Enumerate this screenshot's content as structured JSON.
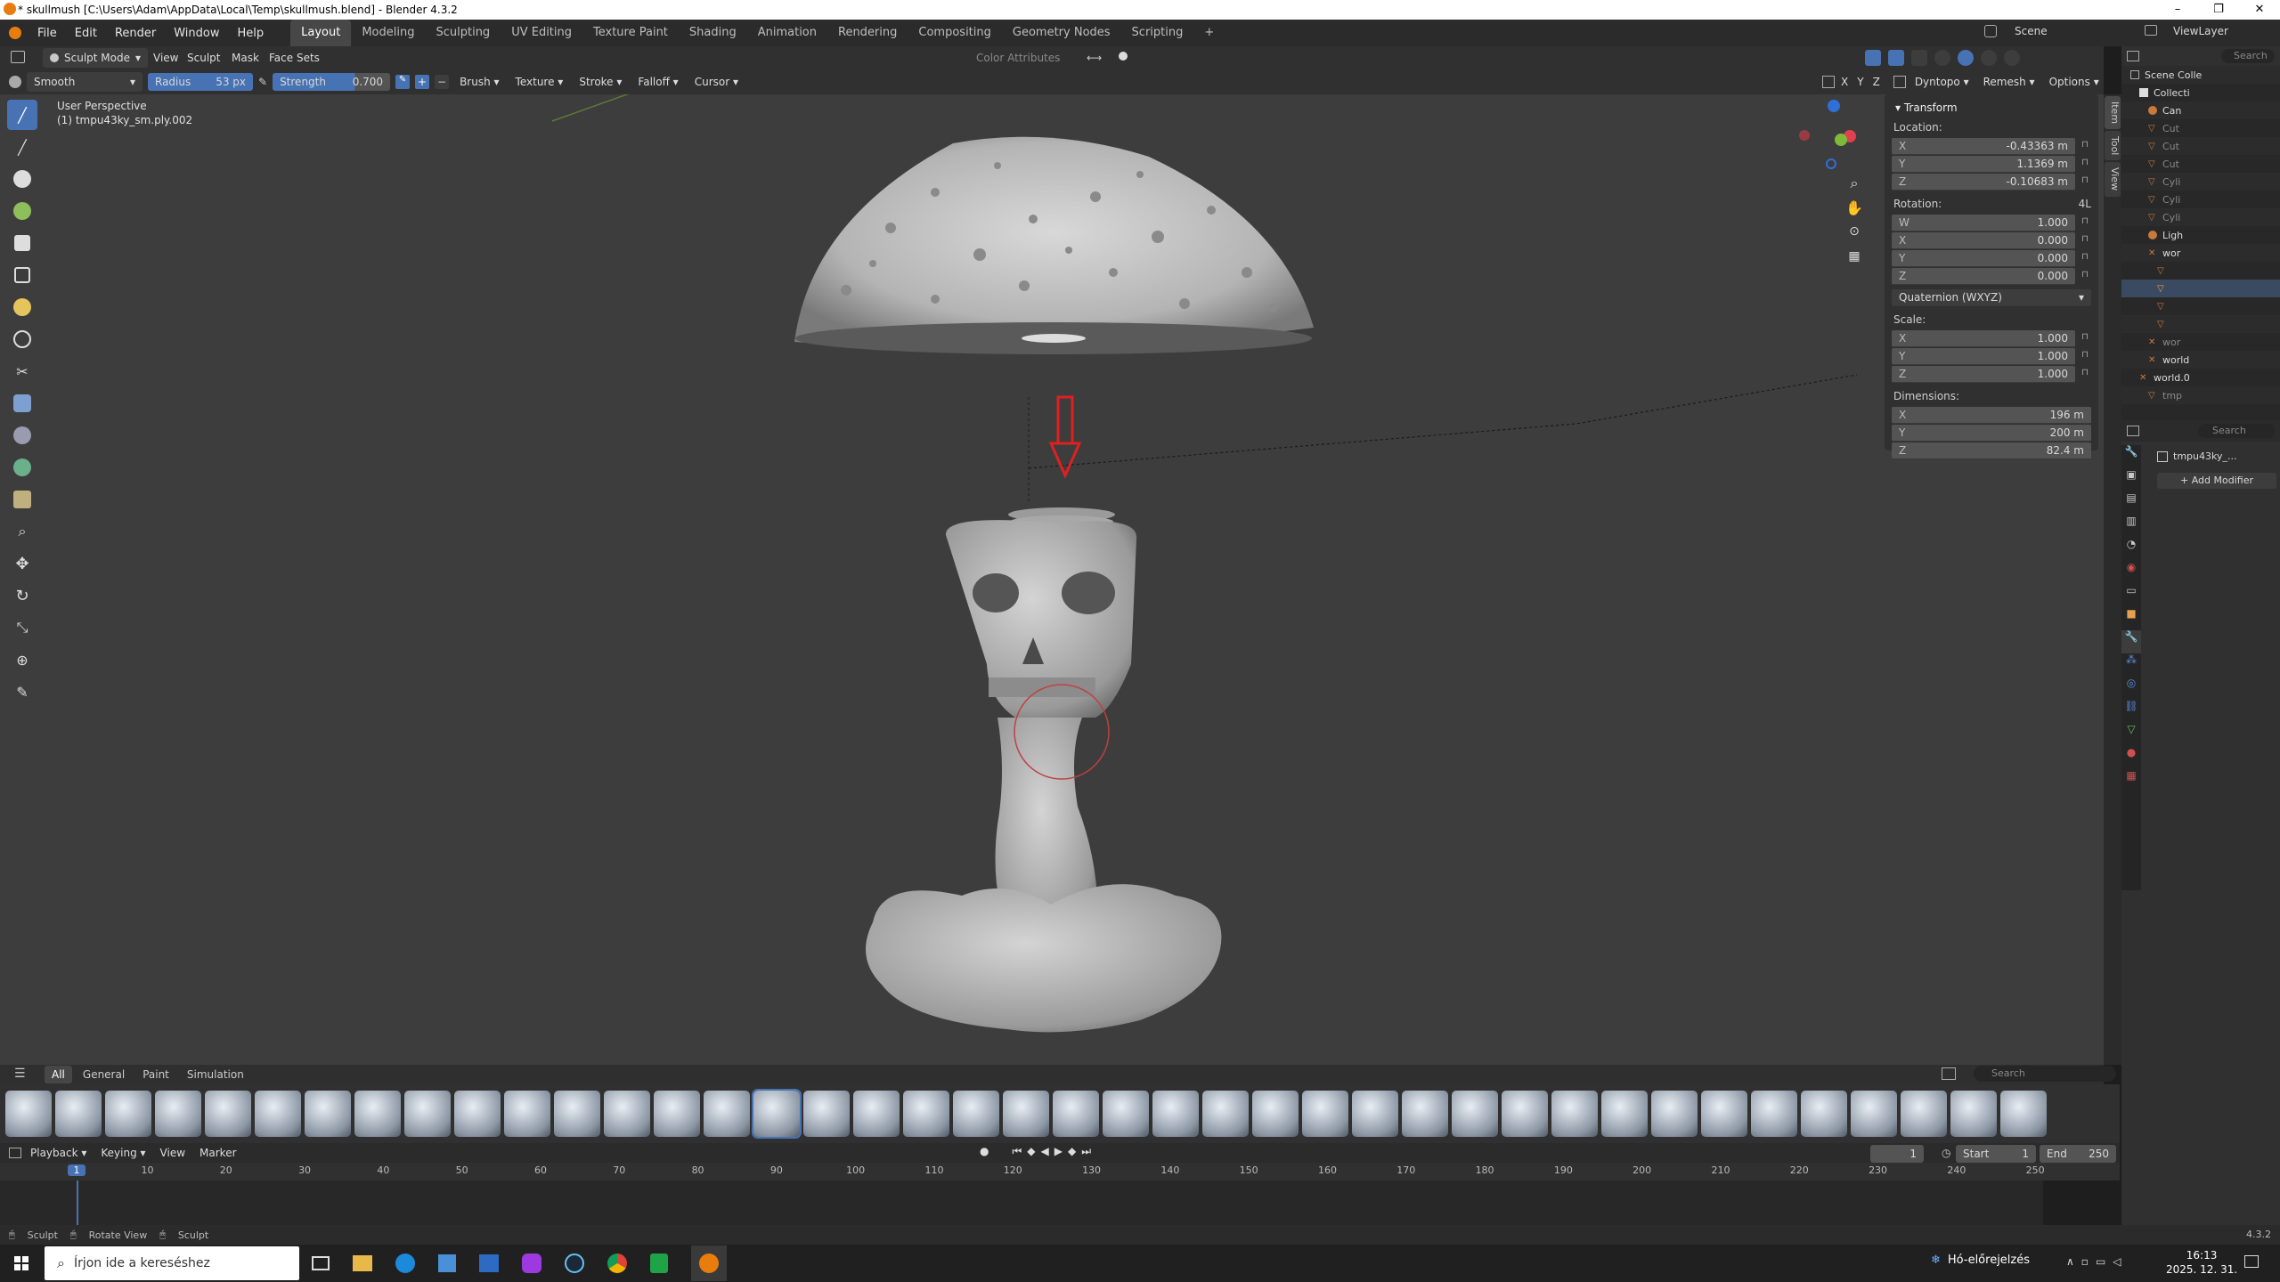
{
  "window": {
    "title": "* skullmush [C:\\Users\\Adam\\AppData\\Local\\Temp\\skullmush.blend] - Blender 4.3.2",
    "controls": [
      "–",
      "❐",
      "✕"
    ]
  },
  "menu": [
    "File",
    "Edit",
    "Render",
    "Window",
    "Help"
  ],
  "workspaces": [
    "Layout",
    "Modeling",
    "Sculpting",
    "UV Editing",
    "Texture Paint",
    "Shading",
    "Animation",
    "Rendering",
    "Compositing",
    "Geometry Nodes",
    "Scripting",
    "+"
  ],
  "scene": {
    "name": "Scene",
    "view_layer": "ViewLayer"
  },
  "viewport_header": {
    "mode": "Sculpt Mode",
    "menus": [
      "View",
      "Sculpt",
      "Mask",
      "Face Sets"
    ],
    "color_attributes": "Color Attributes",
    "right": {
      "dyntopo": "Dyntopo",
      "remesh": "Remesh",
      "options": "Options",
      "axes": [
        "X",
        "Y",
        "Z"
      ]
    }
  },
  "tool_header": {
    "brush": "Smooth",
    "radius_label": "Radius",
    "radius_value": "53 px",
    "strength_label": "Strength",
    "strength_value": "0.700",
    "menus": [
      "Brush",
      "Texture",
      "Stroke",
      "Falloff",
      "Cursor"
    ]
  },
  "viewport": {
    "perspective": "User Perspective",
    "object": "(1) tmpu43ky_sm.ply.002"
  },
  "npanel": {
    "tabs": [
      "Item",
      "Tool",
      "View"
    ],
    "section": "Transform",
    "location_label": "Location:",
    "location": [
      {
        "k": "X",
        "v": "-0.43363 m"
      },
      {
        "k": "Y",
        "v": "1.1369 m"
      },
      {
        "k": "Z",
        "v": "-0.10683 m"
      }
    ],
    "rotation_label": "Rotation:",
    "rotation_mode_tag": "4L",
    "rotation": [
      {
        "k": "W",
        "v": "1.000"
      },
      {
        "k": "X",
        "v": "0.000"
      },
      {
        "k": "Y",
        "v": "0.000"
      },
      {
        "k": "Z",
        "v": "0.000"
      }
    ],
    "rotation_mode": "Quaternion (WXYZ)",
    "scale_label": "Scale:",
    "scale": [
      {
        "k": "X",
        "v": "1.000"
      },
      {
        "k": "Y",
        "v": "1.000"
      },
      {
        "k": "Z",
        "v": "1.000"
      }
    ],
    "dimensions_label": "Dimensions:",
    "dimensions": [
      {
        "k": "X",
        "v": "196 m"
      },
      {
        "k": "Y",
        "v": "200 m"
      },
      {
        "k": "Z",
        "v": "82.4 m"
      }
    ]
  },
  "outliner": {
    "search_placeholder": "Search",
    "rows": [
      "Scene Colle",
      "Collecti",
      "Can",
      "Cut",
      "Cut",
      "Cut",
      "Cyli",
      "Cyli",
      "Cyli",
      "Ligh",
      "wor",
      "",
      "",
      "",
      "",
      "wor",
      "world",
      "world.0",
      "tmp"
    ]
  },
  "properties": {
    "search_placeholder": "Search",
    "object_name": "tmpu43ky_...",
    "add_modifier": "Add Modifier"
  },
  "asset_shelf": {
    "tabs": [
      "All",
      "General",
      "Paint",
      "Simulation"
    ],
    "search_placeholder": "Search",
    "brush_count": 41,
    "selected_index": 15
  },
  "timeline": {
    "menus": [
      "Playback",
      "Keying",
      "View",
      "Marker"
    ],
    "current_frame": "1",
    "start_label": "Start",
    "start": "1",
    "end_label": "End",
    "end": "250",
    "ruler": [
      "1",
      "10",
      "20",
      "30",
      "40",
      "50",
      "60",
      "70",
      "80",
      "90",
      "100",
      "110",
      "120",
      "130",
      "140",
      "150",
      "160",
      "170",
      "180",
      "190",
      "200",
      "210",
      "220",
      "230",
      "240",
      "250"
    ]
  },
  "statusbar": {
    "items": [
      "Sculpt",
      "Rotate View",
      "Sculpt"
    ],
    "version": "4.3.2"
  },
  "taskbar": {
    "search_placeholder": "Írjon ide a kereséshez",
    "weather": "Hó-előrejelzés",
    "time": "16:13",
    "date": "2025. 12. 31."
  },
  "colors": {
    "accent": "#4772b3",
    "arrow": "#e02020",
    "brush_cursor": "#c04040"
  }
}
